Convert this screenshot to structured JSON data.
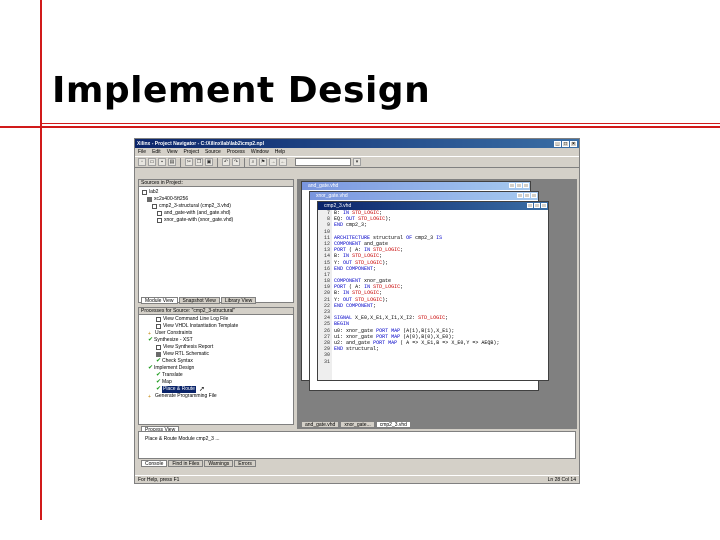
{
  "slide": {
    "title": "Implement Design"
  },
  "window": {
    "title": "Xilinx - Project Navigator - C:\\Xilinx\\lab\\lab2\\cmp2.npl",
    "menus": [
      "File",
      "Edit",
      "View",
      "Project",
      "Source",
      "Process",
      "Window",
      "Help"
    ],
    "toolbar_icons": [
      "new-icon",
      "open-icon",
      "save-icon",
      "print-icon",
      "cut-icon",
      "copy-icon",
      "paste-icon",
      "undo-icon",
      "redo-icon",
      "find-icon",
      "bookmark-icon",
      "indent-icon",
      "outdent-icon"
    ]
  },
  "sources": {
    "header": "Sources in Project:",
    "items": [
      {
        "label": "lab2",
        "icon": "folder-icon",
        "indent": 0
      },
      {
        "label": "xc2s400-5ft256",
        "icon": "chip-icon",
        "indent": 1
      },
      {
        "label": "cmp2_3-structural (cmp2_3.vhd)",
        "icon": "vhdl-icon",
        "indent": 2
      },
      {
        "label": "and_gate-with (and_gate.vhd)",
        "icon": "vhdl-icon",
        "indent": 3
      },
      {
        "label": "xnor_gate-with (xnor_gate.vhd)",
        "icon": "vhdl-icon",
        "indent": 3
      }
    ],
    "tabs": [
      "Module View",
      "Snapshot View",
      "Library View"
    ]
  },
  "processes": {
    "header": "Processes for Source: \"cmp2_3-structural\"",
    "items": [
      {
        "label": "View Command Line Log File",
        "state": "doc",
        "indent": 1
      },
      {
        "label": "View VHDL Instantiation Template",
        "state": "doc",
        "indent": 1
      },
      {
        "label": "User Constraints",
        "state": "none",
        "indent": 0
      },
      {
        "label": "Synthesize - XST",
        "state": "check",
        "indent": 0
      },
      {
        "label": "View Synthesis Report",
        "state": "doc",
        "indent": 1
      },
      {
        "label": "View RTL Schematic",
        "state": "doc",
        "indent": 1
      },
      {
        "label": "Check Syntax",
        "state": "check",
        "indent": 1
      },
      {
        "label": "Implement Design",
        "state": "check",
        "indent": 0
      },
      {
        "label": "Translate",
        "state": "check",
        "indent": 1
      },
      {
        "label": "Map",
        "state": "check",
        "indent": 1
      },
      {
        "label": "Place & Route",
        "state": "selected",
        "indent": 1
      },
      {
        "label": "Generate Programming File",
        "state": "none",
        "indent": 0
      }
    ],
    "tab": "Process View"
  },
  "editor": {
    "back_titles": [
      "and_gate.vhd",
      "xnor_gate.vhd"
    ],
    "front_title": "cmp2_3.vhd",
    "line_numbers": [
      "7",
      "8",
      "9",
      "10",
      "11",
      "12",
      "13",
      "14",
      "15",
      "16",
      "17",
      "18",
      "19",
      "20",
      "21",
      "22",
      "23",
      "24",
      "25",
      "26",
      "27",
      "28",
      "29",
      "30",
      "31"
    ],
    "lines": [
      "        B: IN STD_LOGIC;",
      "        EQ: OUT STD_LOGIC);",
      "END cmp2_3;",
      "",
      "ARCHITECTURE structural OF cmp2_3 IS",
      "COMPONENT and_gate",
      "PORT ( A: IN STD_LOGIC;",
      "       B: IN STD_LOGIC;",
      "       Y: OUT STD_LOGIC);",
      "END COMPONENT;",
      "",
      "COMPONENT xnor_gate",
      "PORT ( A: IN STD_LOGIC;",
      "       B: IN STD_LOGIC;",
      "       Y: OUT STD_LOGIC);",
      "END COMPONENT;",
      "",
      "SIGNAL X_E0,X_E1,X_I1,X_I2: STD_LOGIC;",
      "BEGIN",
      "u0: xnor_gate PORT MAP (A(1),B(1),X_E1);",
      "u1: xnor_gate PORT MAP (A(0),B(0),X_E0);",
      "u2: and_gate PORT MAP ( A => X_E1,B => X_E0,Y => AEQB);",
      "END structural;",
      "",
      ""
    ],
    "doc_tabs": [
      "and_gate.vhd",
      "xnor_gate...",
      "cmp2_3.vhd"
    ]
  },
  "console": {
    "text": "Place & Route Module cmp2_3 ...",
    "tabs": [
      "Console",
      "Find in Files",
      "Warnings",
      "Errors"
    ]
  },
  "status": {
    "left": "For Help, press F1",
    "right": "Ln 28 Col 14"
  }
}
